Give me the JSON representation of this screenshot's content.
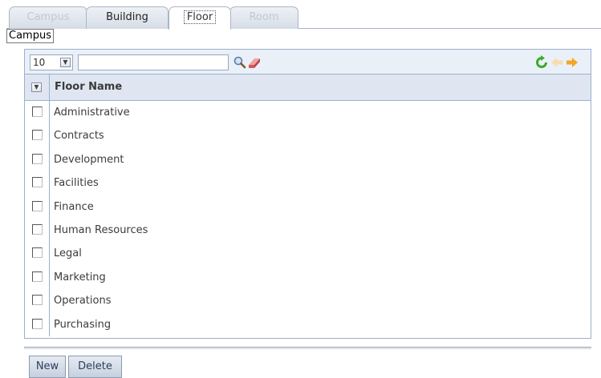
{
  "tabs": [
    {
      "label": "Campus",
      "state": "disabled"
    },
    {
      "label": "Building",
      "state": "enabled"
    },
    {
      "label": "Floor",
      "state": "active"
    },
    {
      "label": "Room",
      "state": "disabled"
    }
  ],
  "tooltip": "Campus",
  "toolbar": {
    "page_size": "10",
    "search_value": ""
  },
  "grid": {
    "column_header": "Floor Name",
    "rows": [
      "Administrative",
      "Contracts",
      "Development",
      "Facilities",
      "Finance",
      "Human Resources",
      "Legal",
      "Marketing",
      "Operations",
      "Purchasing"
    ]
  },
  "actions": {
    "new_label": "New",
    "delete_label": "Delete"
  },
  "icons": [
    "search-icon",
    "eraser-icon",
    "refresh-icon",
    "prev-page-icon",
    "next-page-icon",
    "chevron-down-icon"
  ],
  "colors": {
    "panel_border": "#9db0cc",
    "header_bg": "#dfe6f1",
    "toolbar_bg": "#eaf0f8",
    "refresh_green": "#3cab2a",
    "arrow_orange": "#f5a623"
  }
}
